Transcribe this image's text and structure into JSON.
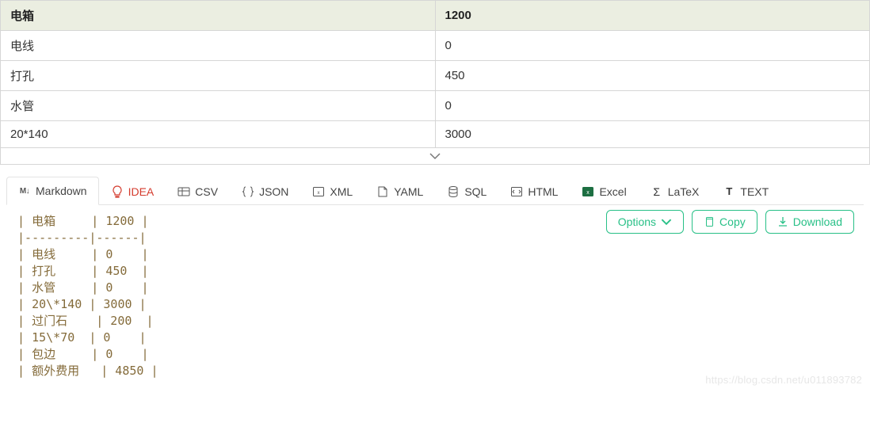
{
  "table": {
    "header": {
      "c0": "电箱",
      "c1": "1200"
    },
    "rows": [
      {
        "c0": "电线",
        "c1": "0"
      },
      {
        "c0": "打孔",
        "c1": "450"
      },
      {
        "c0": "水管",
        "c1": "0"
      },
      {
        "c0": "20*140",
        "c1": "3000"
      }
    ]
  },
  "tabs": {
    "markdown": "Markdown",
    "idea": "IDEA",
    "csv": "CSV",
    "json": "JSON",
    "xml": "XML",
    "yaml": "YAML",
    "sql": "SQL",
    "html": "HTML",
    "excel": "Excel",
    "latex": "LaTeX",
    "text": "TEXT"
  },
  "buttons": {
    "options": "Options",
    "copy": "Copy",
    "download": "Download"
  },
  "code_lines": [
    "| 电箱     | 1200 |",
    "|---------|------|",
    "| 电线     | 0    |",
    "| 打孔     | 450  |",
    "| 水管     | 0    |",
    "| 20\\*140 | 3000 |",
    "| 过门石    | 200  |",
    "| 15\\*70  | 0    |",
    "| 包边     | 0    |",
    "| 额外费用   | 4850 |"
  ],
  "watermark": "https://blog.csdn.net/u011893782"
}
